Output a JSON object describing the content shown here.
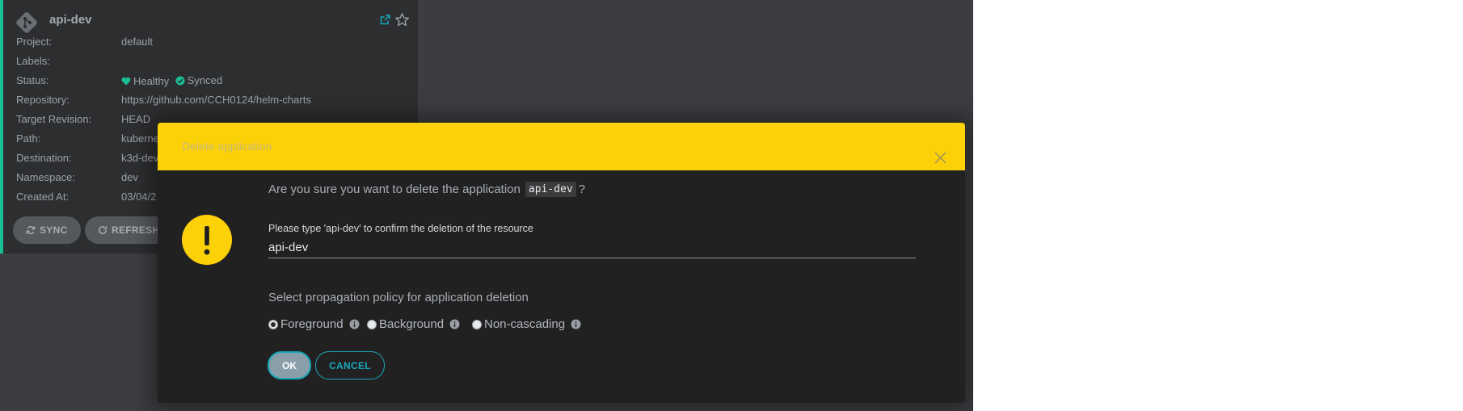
{
  "card": {
    "title": "api-dev",
    "rows": [
      {
        "key": "Project:",
        "value": "default"
      },
      {
        "key": "Labels:",
        "value": ""
      },
      {
        "key": "Status:",
        "health": "Healthy",
        "sync": "Synced"
      },
      {
        "key": "Repository:",
        "value": "https://github.com/CCH0124/helm-charts"
      },
      {
        "key": "Target Revision:",
        "value": "HEAD"
      },
      {
        "key": "Path:",
        "value": "kubernet"
      },
      {
        "key": "Destination:",
        "value": "k3d-dev-"
      },
      {
        "key": "Namespace:",
        "value": "dev"
      },
      {
        "key": "Created At:",
        "value": "03/04/2"
      }
    ],
    "buttons": {
      "sync": "SYNC",
      "refresh": "REFRESH"
    },
    "colors": {
      "health": "#18be94",
      "sync": "#18be94",
      "accent": "#18be94"
    }
  },
  "modal": {
    "title": "Delete application",
    "question_prefix": "Are you sure you want to delete the application",
    "app_name": "api-dev",
    "question_suffix": "?",
    "confirm_label": "Please type 'api-dev' to confirm the deletion of the resource",
    "confirm_value": "api-dev",
    "policy_label": "Select propagation policy for application deletion",
    "options": [
      {
        "label": "Foreground",
        "selected": true
      },
      {
        "label": "Background",
        "selected": false
      },
      {
        "label": "Non-cascading",
        "selected": false
      }
    ],
    "ok_label": "OK",
    "cancel_label": "CANCEL",
    "icons": {
      "warning": "exclamation-icon",
      "close": "close-icon",
      "info": "info-icon"
    },
    "colors": {
      "header": "#fdd108",
      "button": "#18a7b8"
    }
  }
}
